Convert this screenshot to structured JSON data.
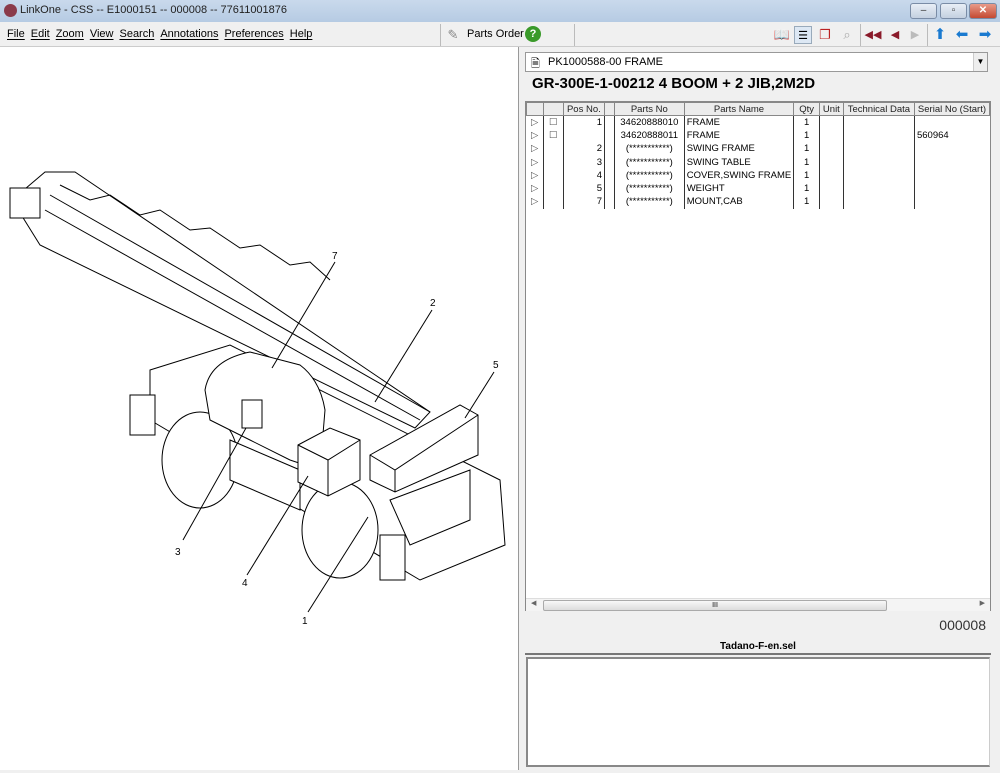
{
  "window": {
    "title": "LinkOne - CSS -- E1000151 -- 000008 -- 77611001876"
  },
  "menu": [
    "File",
    "Edit",
    "Zoom",
    "View",
    "Search",
    "Annotations",
    "Preferences",
    "Help"
  ],
  "toolbar": {
    "parts_order": "Parts Order"
  },
  "illustration": {
    "callouts": [
      "1",
      "2",
      "3",
      "4",
      "5",
      "7"
    ]
  },
  "page_select": {
    "value": "PK1000588-00 FRAME"
  },
  "heading": "GR-300E-1-00212 4 BOOM + 2 JIB,2M2D",
  "table": {
    "columns": [
      "",
      "",
      "Pos No.",
      "",
      "Parts No",
      "Parts Name",
      "Qty",
      "Unit",
      "Technical Data",
      "Serial No (Start)"
    ],
    "rows": [
      {
        "pos": "1",
        "check": true,
        "parts_no": "34620888010",
        "name": "FRAME",
        "qty": "1",
        "serial": ""
      },
      {
        "pos": "",
        "check": true,
        "parts_no": "34620888011",
        "name": "FRAME",
        "qty": "1",
        "serial": "560964"
      },
      {
        "pos": "2",
        "check": false,
        "parts_no": "(***********)",
        "name": "SWING FRAME",
        "qty": "1",
        "serial": ""
      },
      {
        "pos": "3",
        "check": false,
        "parts_no": "(***********)",
        "name": "SWING TABLE",
        "qty": "1",
        "serial": ""
      },
      {
        "pos": "4",
        "check": false,
        "parts_no": "(***********)",
        "name": "COVER,SWING FRAME",
        "qty": "1",
        "serial": ""
      },
      {
        "pos": "5",
        "check": false,
        "parts_no": "(***********)",
        "name": "WEIGHT",
        "qty": "1",
        "serial": ""
      },
      {
        "pos": "7",
        "check": false,
        "parts_no": "(***********)",
        "name": "MOUNT,CAB",
        "qty": "1",
        "serial": ""
      }
    ]
  },
  "page_number": "000008",
  "selection": {
    "title": "Tadano-F-en.sel"
  }
}
